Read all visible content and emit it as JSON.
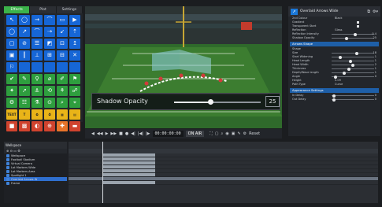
{
  "palette": {
    "tabs": [
      "Effects",
      "Plot",
      "Settings"
    ],
    "active_tab": "Effects",
    "tiles": [
      {
        "glyph": "↖",
        "color": "blue",
        "icon": "pointer-icon"
      },
      {
        "glyph": "◯",
        "color": "blue",
        "icon": "circle-icon"
      },
      {
        "glyph": "→",
        "color": "blue",
        "icon": "arrow-icon"
      },
      {
        "glyph": "⌒",
        "color": "blue",
        "icon": "curve-icon"
      },
      {
        "glyph": "▭",
        "color": "blue",
        "icon": "rect-icon"
      },
      {
        "glyph": "▶",
        "color": "blue",
        "icon": "play-icon"
      },
      {
        "glyph": "◯",
        "color": "blue",
        "icon": "ring-icon"
      },
      {
        "glyph": "↗",
        "color": "blue",
        "icon": "diag-arrow-icon"
      },
      {
        "glyph": "⌒",
        "color": "blue",
        "icon": "arc-icon"
      },
      {
        "glyph": "⇢",
        "color": "blue",
        "icon": "dash-arrow-icon"
      },
      {
        "glyph": "↙",
        "color": "blue",
        "icon": "back-arrow-icon"
      },
      {
        "glyph": "⇡",
        "color": "blue",
        "icon": "up-arrow-icon"
      },
      {
        "glyph": "▢",
        "color": "blue",
        "icon": "square-icon"
      },
      {
        "glyph": "⊘",
        "color": "blue",
        "icon": "no-icon"
      },
      {
        "glyph": "☰",
        "color": "blue",
        "icon": "list-icon"
      },
      {
        "glyph": "◩",
        "color": "blue",
        "icon": "zone-icon"
      },
      {
        "glyph": "⊡",
        "color": "blue",
        "icon": "box-icon"
      },
      {
        "glyph": "↥",
        "color": "blue",
        "icon": "lift-icon"
      },
      {
        "glyph": "▣",
        "color": "blue",
        "icon": "grid-icon"
      },
      {
        "glyph": "┃",
        "color": "blue",
        "icon": "bar-icon"
      },
      {
        "glyph": "⊥",
        "color": "blue",
        "icon": "line-icon"
      },
      {
        "glyph": "⊞",
        "color": "blue",
        "icon": "formation-icon"
      },
      {
        "glyph": "⊟",
        "color": "blue",
        "icon": "panel-icon"
      },
      {
        "glyph": "✕",
        "color": "blue",
        "icon": "cross-icon"
      },
      {
        "glyph": "⚐",
        "color": "blue",
        "icon": "flag-icon"
      },
      {
        "glyph": "",
        "color": "blue",
        "icon": "empty-icon"
      },
      {
        "glyph": "",
        "color": "blue",
        "icon": "empty-icon"
      },
      {
        "glyph": "",
        "color": "blue",
        "icon": "empty-icon"
      },
      {
        "glyph": "",
        "color": "blue",
        "icon": "empty-icon"
      },
      {
        "glyph": "",
        "color": "blue",
        "icon": "empty-icon"
      },
      {
        "glyph": "✔",
        "color": "green",
        "icon": "check-icon"
      },
      {
        "glyph": "✎",
        "color": "green",
        "icon": "pen-icon"
      },
      {
        "glyph": "⚲",
        "color": "green",
        "icon": "pin-icon"
      },
      {
        "glyph": "⌀",
        "color": "green",
        "icon": "diameter-icon"
      },
      {
        "glyph": "✐",
        "color": "green",
        "icon": "draw-icon"
      },
      {
        "glyph": "⚑",
        "color": "green",
        "icon": "marker-icon"
      },
      {
        "glyph": "✦",
        "color": "green",
        "icon": "spark-icon"
      },
      {
        "glyph": "➚",
        "color": "green",
        "icon": "trend-icon"
      },
      {
        "glyph": "⚓",
        "color": "green",
        "icon": "anchor-icon"
      },
      {
        "glyph": "⟲",
        "color": "green",
        "icon": "rotate-icon"
      },
      {
        "glyph": "⚘",
        "color": "green",
        "icon": "flower-icon"
      },
      {
        "glyph": "☍",
        "color": "green",
        "icon": "link-icon"
      },
      {
        "glyph": "⚙",
        "color": "green",
        "icon": "gear-icon"
      },
      {
        "glyph": "☷",
        "color": "green",
        "icon": "grid-alt-icon"
      },
      {
        "glyph": "⚗",
        "color": "green",
        "icon": "tool-icon"
      },
      {
        "glyph": "⊙",
        "color": "green",
        "icon": "target-icon"
      },
      {
        "glyph": "⌕",
        "color": "green",
        "icon": "zoom-icon"
      },
      {
        "glyph": "⌖",
        "color": "green",
        "icon": "crosshair-icon"
      },
      {
        "glyph": "TEXT",
        "color": "yellow",
        "icon": "text-icon"
      },
      {
        "glyph": "T",
        "color": "yellow",
        "icon": "title-icon"
      },
      {
        "glyph": "⏲",
        "color": "yellow",
        "icon": "timer-icon"
      },
      {
        "glyph": "⏱",
        "color": "yellow",
        "icon": "stopwatch-icon"
      },
      {
        "glyph": "▦",
        "color": "yellow",
        "icon": "table-icon"
      },
      {
        "glyph": "▤",
        "color": "yellow",
        "icon": "board-icon"
      },
      {
        "glyph": "■",
        "color": "red",
        "icon": "stop-icon"
      },
      {
        "glyph": "▩",
        "color": "red",
        "icon": "score-icon"
      },
      {
        "glyph": "◐",
        "color": "red",
        "icon": "half-icon"
      },
      {
        "glyph": "⊕",
        "color": "red",
        "icon": "add-icon"
      },
      {
        "glyph": "✚",
        "color": "orange",
        "icon": "plus-icon"
      },
      {
        "glyph": "▬",
        "color": "red",
        "icon": "band-icon"
      }
    ]
  },
  "viewport": {
    "shadow_label": "Shadow Opacity",
    "shadow_value": "25",
    "shadow_level": 0.42
  },
  "transport": {
    "buttons": [
      "◀",
      "◀◀",
      "▶",
      "▶▶",
      "■",
      "●",
      "◀|",
      "|◀|",
      "|▶"
    ],
    "timecode": "00:00:00:00",
    "on_air": "ON AIR",
    "right_buttons": [
      "⛶",
      "▢",
      "⌕",
      "◉",
      "▣",
      "✎",
      "⚙",
      "Reset"
    ]
  },
  "properties": {
    "title": "Overlaid Arrows Wide",
    "head_buttons": [
      "⧉",
      "⚙▾"
    ],
    "rows_top": [
      {
        "label": "2nd Colour",
        "value": "Black"
      },
      {
        "label": "Gradient",
        "check": true
      },
      {
        "label": "Transparent Start",
        "check": true
      },
      {
        "label": "Reflection",
        "value": "Glass"
      },
      {
        "label": "Reflection Intensity",
        "level": 0.55,
        "num": "0.4"
      },
      {
        "label": "Shadow Opacity",
        "level": 0.35,
        "num": "25"
      }
    ],
    "section1": "Arrows Shape",
    "rows_mid": [
      {
        "label": "Shape",
        "value": ""
      },
      {
        "label": "Size",
        "level": 0.6,
        "num": "18"
      },
      {
        "label": "Start Widening",
        "level": 0.2,
        "num": "1"
      },
      {
        "label": "Head Length",
        "level": 0.45,
        "num": "1"
      },
      {
        "label": "Head Width",
        "level": 0.5,
        "num": "2"
      },
      {
        "label": "Thickness",
        "level": 0.4,
        "num": "1"
      },
      {
        "label": "Depth/Wave length",
        "level": 0.3,
        "num": "1"
      },
      {
        "label": "Angle",
        "level": 0.1,
        "num": "0"
      },
      {
        "label": "Height",
        "value": "0.09"
      },
      {
        "label": "Path Type",
        "value": "Curve"
      }
    ],
    "section2": "Appearance Settings",
    "rows_bottom": [
      {
        "label": "In Delay",
        "level": 0.05,
        "num": "0"
      },
      {
        "label": "Out Delay",
        "level": 0.05,
        "num": "0"
      }
    ]
  },
  "layers": {
    "title": "Wellspace",
    "tools": "⊕ ⊖ ▭ ⚙",
    "items": [
      {
        "name": "Wellspace",
        "selected": false
      },
      {
        "name": "Football Stadium",
        "selected": false
      },
      {
        "name": "Virtual Camera",
        "selected": false
      },
      {
        "name": "Lot Markers Wide",
        "selected": false
      },
      {
        "name": "Lot Markers Area",
        "selected": false
      },
      {
        "name": "Spotlight 1",
        "selected": false
      },
      {
        "name": "Overlaid Arrows W",
        "selected": true
      },
      {
        "name": "Frame",
        "selected": false
      }
    ]
  },
  "timeline": {
    "playhead": 0.11,
    "clips": [
      {
        "row": 0,
        "start": 0.11,
        "end": 0.28
      },
      {
        "row": 1,
        "start": 0.11,
        "end": 0.28
      },
      {
        "row": 2,
        "start": 0.11,
        "end": 0.28
      },
      {
        "row": 3,
        "start": 0.11,
        "end": 0.28
      },
      {
        "row": 4,
        "start": 0.11,
        "end": 0.28
      },
      {
        "row": 5,
        "start": 0.11,
        "end": 0.28
      },
      {
        "row": 6,
        "start": 0.0,
        "end": 1.0
      },
      {
        "row": 7,
        "start": 0.11,
        "end": 0.28
      }
    ]
  }
}
